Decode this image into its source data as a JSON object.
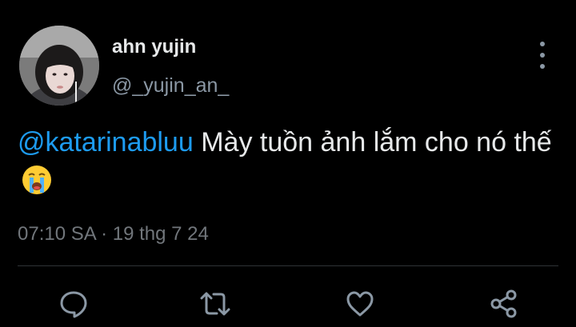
{
  "author": {
    "display_name": "ahn yujin",
    "handle": "@_yujin_an_",
    "avatar_icon": "profile-photo"
  },
  "tweet": {
    "mention": "@katarinabluu",
    "text": "Mày tuồn ảnh lắm cho nó thế",
    "emoji": "loudly-crying-face",
    "time": "07:10 SA",
    "separator": "·",
    "date": "19 thg 7 24"
  },
  "actions": [
    {
      "name": "reply",
      "icon": "speech-bubble-icon"
    },
    {
      "name": "retweet",
      "icon": "retweet-arrows-icon"
    },
    {
      "name": "like",
      "icon": "heart-icon"
    },
    {
      "name": "share",
      "icon": "share-nodes-icon"
    }
  ],
  "colors": {
    "background": "#000000",
    "primary_text": "#e7e9ea",
    "secondary_text": "#8b98a5",
    "mention": "#1d9bf0",
    "divider": "#2f3336"
  }
}
